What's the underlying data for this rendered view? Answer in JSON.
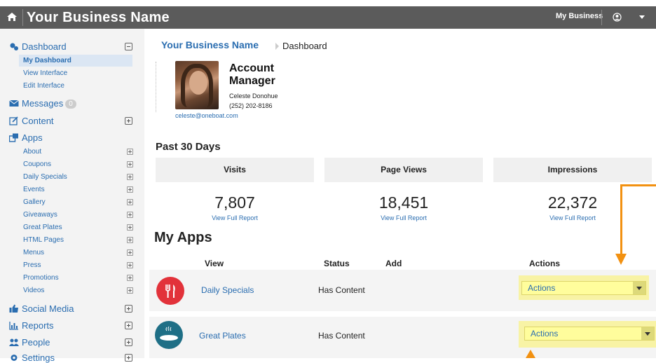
{
  "topbar": {
    "brand": "Your Business Name",
    "my_business": "My Business"
  },
  "sidebar": {
    "dashboard": "Dashboard",
    "dashboard_items": [
      "My Dashboard",
      "View Interface",
      "Edit Interface"
    ],
    "messages": "Messages",
    "messages_count": "0",
    "content": "Content",
    "apps": "Apps",
    "app_items": [
      "About",
      "Coupons",
      "Daily Specials",
      "Events",
      "Gallery",
      "Giveaways",
      "Great Plates",
      "HTML Pages",
      "Menus",
      "Press",
      "Promotions",
      "Videos"
    ],
    "social_media": "Social Media",
    "reports": "Reports",
    "people": "People",
    "settings": "Settings"
  },
  "breadcrumb": {
    "business": "Your Business Name",
    "page": "Dashboard"
  },
  "account_manager": {
    "title": "Account Manager",
    "name": "Celeste Donohue",
    "phone": "(252) 202-8186",
    "email": "celeste@oneboat.com"
  },
  "stats": {
    "heading": "Past 30 Days",
    "items": [
      {
        "label": "Visits",
        "value": "7,807",
        "link": "View Full Report"
      },
      {
        "label": "Page Views",
        "value": "18,451",
        "link": "View Full Report"
      },
      {
        "label": "Impressions",
        "value": "22,372",
        "link": "View Full Report"
      }
    ]
  },
  "apps_table": {
    "heading": "My Apps",
    "columns": [
      "View",
      "Status",
      "Add",
      "Actions"
    ],
    "rows": [
      {
        "name": "Daily Specials",
        "status": "Has Content",
        "action": "Actions",
        "icon": "fork-knife-icon"
      },
      {
        "name": "Great Plates",
        "status": "Has Content",
        "action": "Actions",
        "icon": "plate-icon"
      }
    ]
  },
  "colors": {
    "topbar": "#5b5b5b",
    "link": "#2a6db0",
    "highlight": "#f8f3a5",
    "annotation": "#f29111",
    "daily_specials_icon": "#e2323a",
    "great_plates_icon": "#1f6f86"
  }
}
